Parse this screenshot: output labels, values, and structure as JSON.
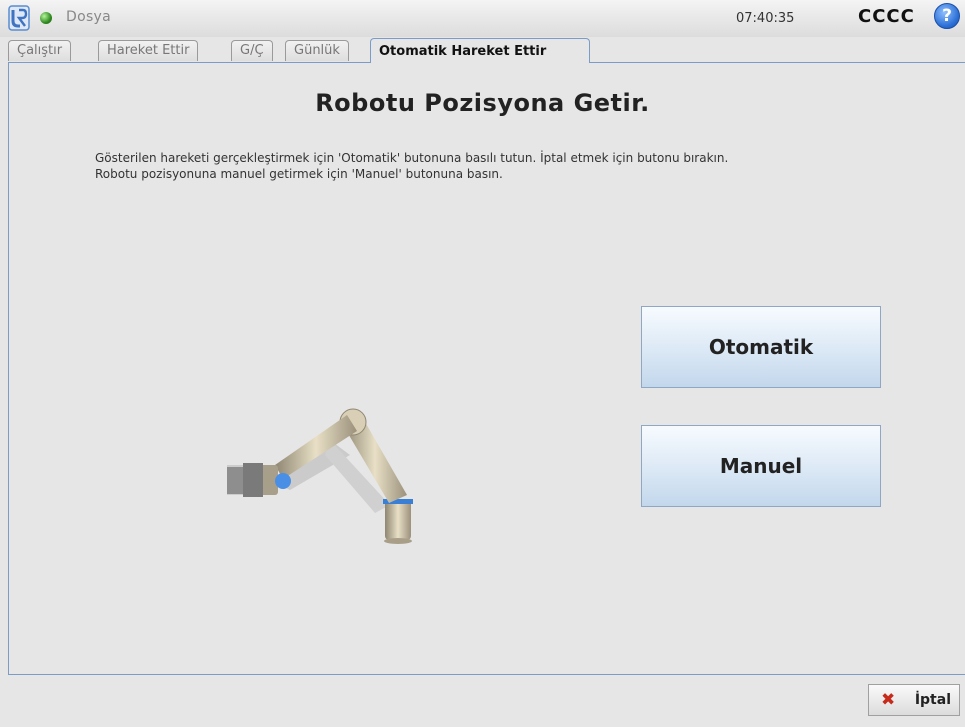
{
  "header": {
    "file_menu": "Dosya",
    "clock": "07:40:35",
    "robot_name": "CCCC",
    "help_glyph": "?"
  },
  "tabs": [
    {
      "label": "Çalıştır"
    },
    {
      "label": "Hareket Ettir"
    },
    {
      "label": "G/Ç"
    },
    {
      "label": "Günlük"
    },
    {
      "label": "Otomatik Hareket Ettir",
      "active": true
    }
  ],
  "main": {
    "title": "Robotu Pozisyona Getir.",
    "instructions": [
      "Gösterilen hareketi gerçekleştirmek için 'Otomatik' butonuna basılı tutun. İptal etmek için butonu bırakın.",
      "Robotu pozisyonuna manuel getirmek için 'Manuel' butonuna basın."
    ],
    "auto_button": "Otomatik",
    "manual_button": "Manuel"
  },
  "footer": {
    "cancel_label": "İptal",
    "cancel_icon": "close-x-icon"
  },
  "icons": {
    "logo": "ur-logo-icon",
    "status": "status-dot-icon",
    "help": "help-icon"
  },
  "colors": {
    "status_dot": "#2f8a1f",
    "accent_border": "#7a9cc6",
    "cancel_icon": "#c62a1a"
  }
}
